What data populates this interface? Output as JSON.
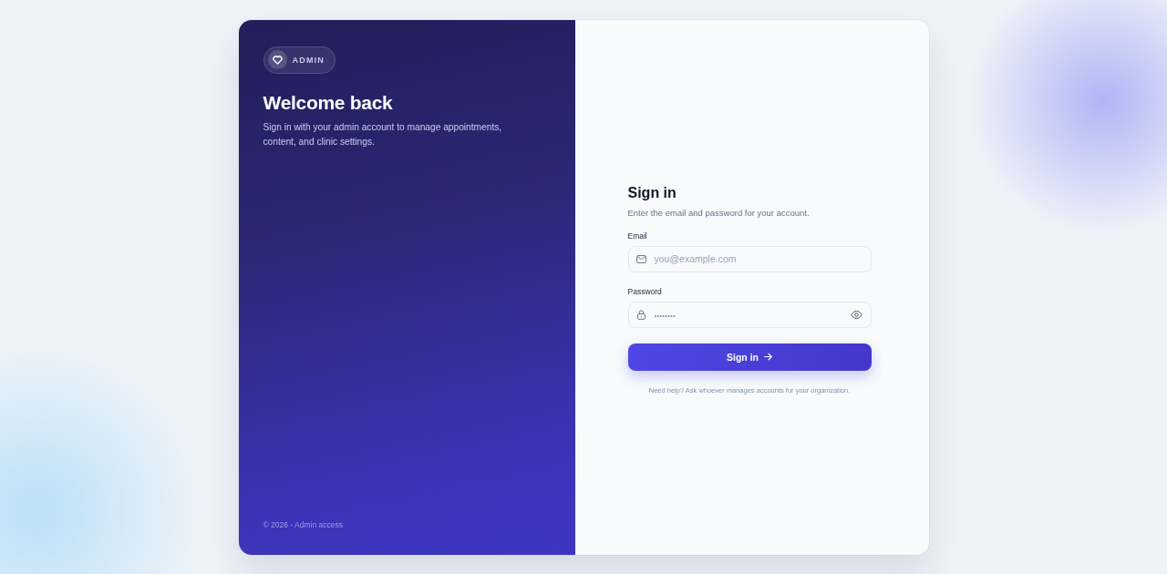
{
  "hero": {
    "badge": "ADMIN",
    "title": "Welcome back",
    "subtitle": "Sign in with your admin account to manage appointments, content, and clinic settings.",
    "footer": "© 2026 - Admin access"
  },
  "form": {
    "title": "Sign in",
    "subtitle": "Enter the email and password for your account.",
    "fields": [
      {
        "kind": "email",
        "label": "Email",
        "placeholder": "you@example.com"
      },
      {
        "kind": "password",
        "label": "Password",
        "placeholder": "••••••••"
      }
    ],
    "submit": "Sign in",
    "help": "Need help? Ask whoever manages accounts for your organization."
  }
}
